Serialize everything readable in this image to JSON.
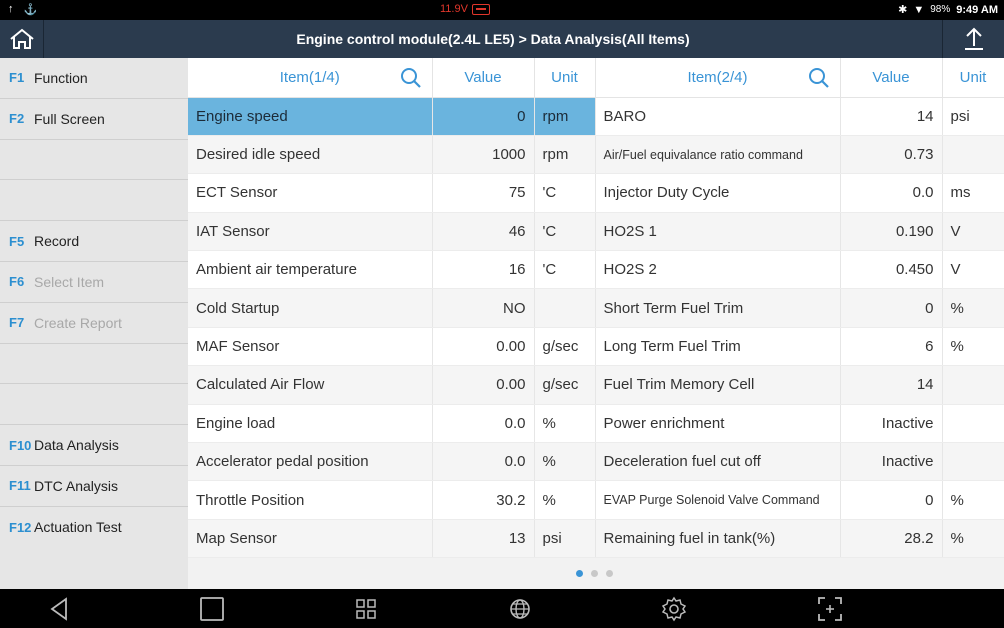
{
  "status_bar": {
    "voltage": "11.9V",
    "battery_pct": "98%",
    "time": "9:49 AM"
  },
  "title": "Engine control module(2.4L LE5)  >  Data Analysis(All Items)",
  "sidebar": [
    {
      "key": "F1",
      "label": "Function",
      "disabled": false
    },
    {
      "key": "F2",
      "label": "Full Screen",
      "disabled": false
    },
    {
      "key": "",
      "label": "",
      "disabled": false
    },
    {
      "key": "",
      "label": "",
      "disabled": false
    },
    {
      "key": "F5",
      "label": "Record",
      "disabled": false
    },
    {
      "key": "F6",
      "label": "Select Item",
      "disabled": true
    },
    {
      "key": "F7",
      "label": "Create Report",
      "disabled": true
    },
    {
      "key": "",
      "label": "",
      "disabled": false
    },
    {
      "key": "",
      "label": "",
      "disabled": false
    },
    {
      "key": "F10",
      "label": "Data Analysis",
      "disabled": false
    },
    {
      "key": "F11",
      "label": "DTC Analysis",
      "disabled": false
    },
    {
      "key": "F12",
      "label": "Actuation Test",
      "disabled": false
    }
  ],
  "table": {
    "headers": {
      "item1": "Item(1/4)",
      "value1": "Value",
      "unit1": "Unit",
      "item2": "Item(2/4)",
      "value2": "Value",
      "unit2": "Unit"
    },
    "rows": [
      {
        "item1": "Engine speed",
        "value1": "0",
        "unit1": "rpm",
        "item2": "BARO",
        "value2": "14",
        "unit2": "psi"
      },
      {
        "item1": "Desired idle speed",
        "value1": "1000",
        "unit1": "rpm",
        "item2": "Air/Fuel equivalance ratio command",
        "value2": "0.73",
        "unit2": ""
      },
      {
        "item1": "ECT Sensor",
        "value1": "75",
        "unit1": "'C",
        "item2": "Injector Duty Cycle",
        "value2": "0.0",
        "unit2": "ms"
      },
      {
        "item1": "IAT Sensor",
        "value1": "46",
        "unit1": "'C",
        "item2": "HO2S 1",
        "value2": "0.190",
        "unit2": "V"
      },
      {
        "item1": "Ambient air temperature",
        "value1": "16",
        "unit1": "'C",
        "item2": "HO2S 2",
        "value2": "0.450",
        "unit2": "V"
      },
      {
        "item1": "Cold Startup",
        "value1": "NO",
        "unit1": "",
        "item2": "Short Term Fuel Trim",
        "value2": "0",
        "unit2": "%"
      },
      {
        "item1": "MAF Sensor",
        "value1": "0.00",
        "unit1": "g/sec",
        "item2": "Long Term Fuel Trim",
        "value2": "6",
        "unit2": "%"
      },
      {
        "item1": "Calculated Air Flow",
        "value1": "0.00",
        "unit1": "g/sec",
        "item2": "Fuel Trim Memory Cell",
        "value2": "14",
        "unit2": ""
      },
      {
        "item1": "Engine load",
        "value1": "0.0",
        "unit1": "%",
        "item2": "Power enrichment",
        "value2": "Inactive",
        "unit2": ""
      },
      {
        "item1": "Accelerator pedal position",
        "value1": "0.0",
        "unit1": "%",
        "item2": "Deceleration fuel cut off",
        "value2": "Inactive",
        "unit2": ""
      },
      {
        "item1": "Throttle Position",
        "value1": "30.2",
        "unit1": "%",
        "item2": "EVAP Purge Solenoid Valve Command",
        "value2": "0",
        "unit2": "%"
      },
      {
        "item1": "Map Sensor",
        "value1": "13",
        "unit1": "psi",
        "item2": "Remaining fuel in tank(%)",
        "value2": "28.2",
        "unit2": "%"
      }
    ]
  },
  "colors": {
    "accent": "#3a94d6",
    "selected_row": "#6ab4de",
    "title_bar": "#2b3b4e",
    "voltage_warning": "#e0362b"
  },
  "icons": {
    "home": "home-icon",
    "export": "export-icon",
    "search": "search-icon",
    "back": "back-icon",
    "home_nav": "home-nav-icon",
    "apps": "apps-icon",
    "browser": "globe-icon",
    "settings": "gear-icon",
    "screenshot": "screenshot-icon"
  }
}
